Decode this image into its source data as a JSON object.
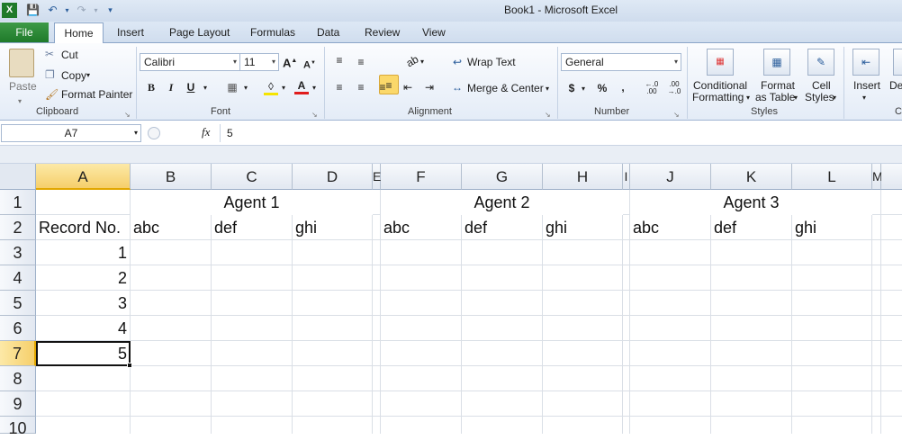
{
  "window": {
    "title": "Book1  -  Microsoft Excel"
  },
  "tabs": {
    "file": "File",
    "home": "Home",
    "insert": "Insert",
    "page_layout": "Page Layout",
    "formulas": "Formulas",
    "data": "Data",
    "review": "Review",
    "view": "View"
  },
  "clipboard": {
    "paste": "Paste",
    "cut": "Cut",
    "copy": "Copy",
    "format_painter": "Format Painter",
    "group": "Clipboard"
  },
  "font": {
    "name": "Calibri",
    "size": "11",
    "bold": "B",
    "italic": "I",
    "underline": "U",
    "group": "Font"
  },
  "alignment": {
    "wrap_text": "Wrap Text",
    "merge_center": "Merge & Center",
    "group": "Alignment"
  },
  "number": {
    "format": "General",
    "currency": "$",
    "percent": "%",
    "comma": ",",
    "inc_decimal": "←.0 .00",
    "dec_decimal": ".00 →.0",
    "group": "Number"
  },
  "styles": {
    "conditional_1": "Conditional",
    "conditional_2": "Formatting",
    "format_table_1": "Format",
    "format_table_2": "as Table",
    "cell_styles_1": "Cell",
    "cell_styles_2": "Styles",
    "group": "Styles"
  },
  "cells": {
    "insert": "Insert",
    "delete": "De",
    "group": "C"
  },
  "formula_bar": {
    "name_box": "A7",
    "fx": "fx",
    "value": "5"
  },
  "columns": [
    "A",
    "B",
    "C",
    "D",
    "E",
    "F",
    "G",
    "H",
    "I",
    "J",
    "K",
    "L",
    "M"
  ],
  "rows": [
    "1",
    "2",
    "3",
    "4",
    "5",
    "6",
    "7",
    "8",
    "9",
    "10"
  ],
  "sheet": {
    "agent1": "Agent 1",
    "agent2": "Agent 2",
    "agent3": "Agent 3",
    "record_no": "Record No.",
    "subheads": [
      "abc",
      "def",
      "ghi",
      "abc",
      "def",
      "ghi",
      "abc",
      "def",
      "ghi"
    ],
    "records": [
      "1",
      "2",
      "3",
      "4",
      "5"
    ]
  },
  "colors": {
    "accent_file_tab": "#1f7a2a",
    "selection_header": "#f6cf6b",
    "grid_line": "#dadfe6"
  }
}
